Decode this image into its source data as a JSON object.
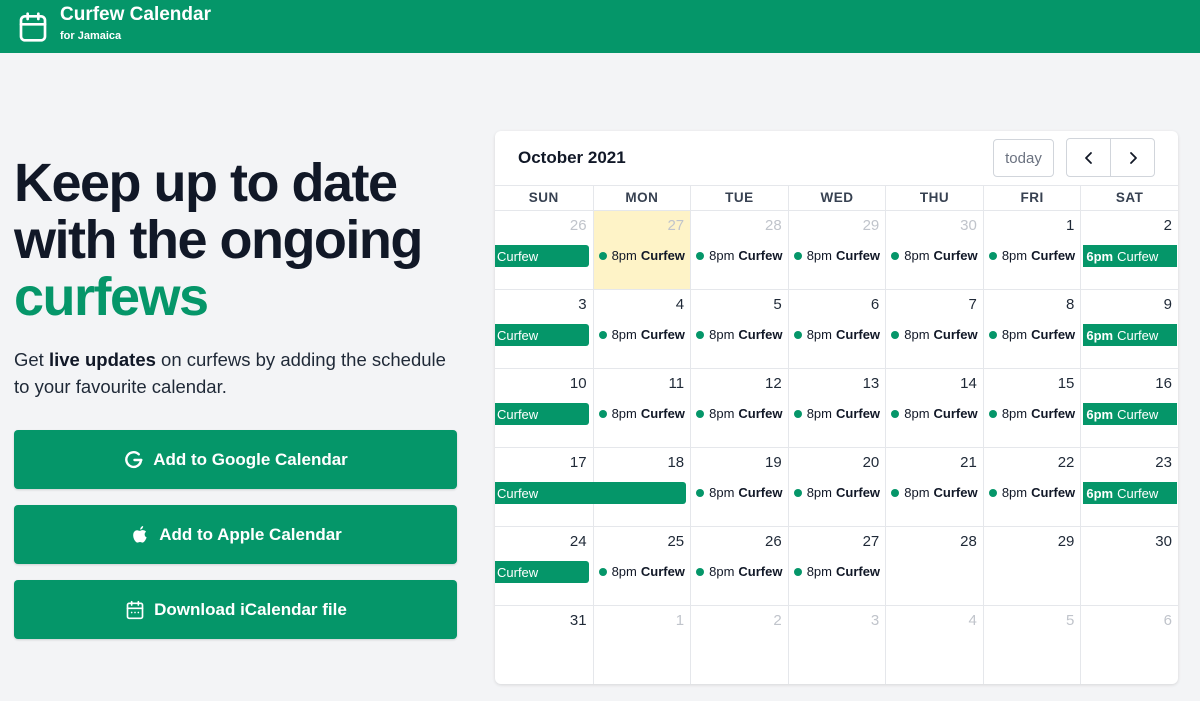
{
  "header": {
    "title": "Curfew Calendar",
    "subtitle": "for Jamaica",
    "logo_icon": "calendar-icon"
  },
  "hero": {
    "headline_line1": "Keep up to date",
    "headline_line2": "with the ongoing",
    "headline_accent": "curfews",
    "intro_prefix": "Get ",
    "intro_bold": "live updates",
    "intro_suffix": " on curfews by adding the schedule to your favourite calendar."
  },
  "buttons": {
    "google": "Add to Google Calendar",
    "apple": "Add to Apple Calendar",
    "ical": "Download iCalendar file"
  },
  "calendar": {
    "title": "October 2021",
    "today_label": "today",
    "days_of_week": [
      "SUN",
      "MON",
      "TUE",
      "WED",
      "THU",
      "FRI",
      "SAT"
    ],
    "weeks": [
      [
        {
          "num": "26",
          "other": true,
          "event": {
            "kind": "bar",
            "title": "Curfew"
          }
        },
        {
          "num": "27",
          "other": true,
          "today": true,
          "event": {
            "kind": "dot",
            "time": "8pm",
            "title": "Curfew"
          }
        },
        {
          "num": "28",
          "other": true,
          "event": {
            "kind": "dot",
            "time": "8pm",
            "title": "Curfew"
          }
        },
        {
          "num": "29",
          "other": true,
          "event": {
            "kind": "dot",
            "time": "8pm",
            "title": "Curfew"
          }
        },
        {
          "num": "30",
          "other": true,
          "event": {
            "kind": "dot",
            "time": "8pm",
            "title": "Curfew"
          }
        },
        {
          "num": "1",
          "event": {
            "kind": "dot",
            "time": "8pm",
            "title": "Curfew"
          }
        },
        {
          "num": "2",
          "event": {
            "kind": "sat",
            "time": "6pm",
            "title": "Curfew"
          }
        }
      ],
      [
        {
          "num": "3",
          "event": {
            "kind": "bar",
            "title": "Curfew"
          }
        },
        {
          "num": "4",
          "event": {
            "kind": "dot",
            "time": "8pm",
            "title": "Curfew"
          }
        },
        {
          "num": "5",
          "event": {
            "kind": "dot",
            "time": "8pm",
            "title": "Curfew"
          }
        },
        {
          "num": "6",
          "event": {
            "kind": "dot",
            "time": "8pm",
            "title": "Curfew"
          }
        },
        {
          "num": "7",
          "event": {
            "kind": "dot",
            "time": "8pm",
            "title": "Curfew"
          }
        },
        {
          "num": "8",
          "event": {
            "kind": "dot",
            "time": "8pm",
            "title": "Curfew"
          }
        },
        {
          "num": "9",
          "event": {
            "kind": "sat",
            "time": "6pm",
            "title": "Curfew"
          }
        }
      ],
      [
        {
          "num": "10",
          "event": {
            "kind": "bar",
            "title": "Curfew"
          }
        },
        {
          "num": "11",
          "event": {
            "kind": "dot",
            "time": "8pm",
            "title": "Curfew"
          }
        },
        {
          "num": "12",
          "event": {
            "kind": "dot",
            "time": "8pm",
            "title": "Curfew"
          }
        },
        {
          "num": "13",
          "event": {
            "kind": "dot",
            "time": "8pm",
            "title": "Curfew"
          }
        },
        {
          "num": "14",
          "event": {
            "kind": "dot",
            "time": "8pm",
            "title": "Curfew"
          }
        },
        {
          "num": "15",
          "event": {
            "kind": "dot",
            "time": "8pm",
            "title": "Curfew"
          }
        },
        {
          "num": "16",
          "event": {
            "kind": "sat",
            "time": "6pm",
            "title": "Curfew"
          }
        }
      ],
      [
        {
          "num": "17",
          "event": {
            "kind": "bar",
            "title": "Curfew",
            "span": 2
          }
        },
        {
          "num": "18"
        },
        {
          "num": "19",
          "event": {
            "kind": "dot",
            "time": "8pm",
            "title": "Curfew"
          }
        },
        {
          "num": "20",
          "event": {
            "kind": "dot",
            "time": "8pm",
            "title": "Curfew"
          }
        },
        {
          "num": "21",
          "event": {
            "kind": "dot",
            "time": "8pm",
            "title": "Curfew"
          }
        },
        {
          "num": "22",
          "event": {
            "kind": "dot",
            "time": "8pm",
            "title": "Curfew"
          }
        },
        {
          "num": "23",
          "event": {
            "kind": "sat",
            "time": "6pm",
            "title": "Curfew"
          }
        }
      ],
      [
        {
          "num": "24",
          "event": {
            "kind": "bar",
            "title": "Curfew"
          }
        },
        {
          "num": "25",
          "event": {
            "kind": "dot",
            "time": "8pm",
            "title": "Curfew"
          }
        },
        {
          "num": "26",
          "event": {
            "kind": "dot",
            "time": "8pm",
            "title": "Curfew"
          }
        },
        {
          "num": "27",
          "event": {
            "kind": "dot",
            "time": "8pm",
            "title": "Curfew"
          }
        },
        {
          "num": "28"
        },
        {
          "num": "29"
        },
        {
          "num": "30"
        }
      ],
      [
        {
          "num": "31"
        },
        {
          "num": "1",
          "other": true
        },
        {
          "num": "2",
          "other": true
        },
        {
          "num": "3",
          "other": true
        },
        {
          "num": "4",
          "other": true
        },
        {
          "num": "5",
          "other": true
        },
        {
          "num": "6",
          "other": true
        }
      ]
    ]
  },
  "colors": {
    "brand": "#059669",
    "today_highlight": "#fef3c7"
  }
}
